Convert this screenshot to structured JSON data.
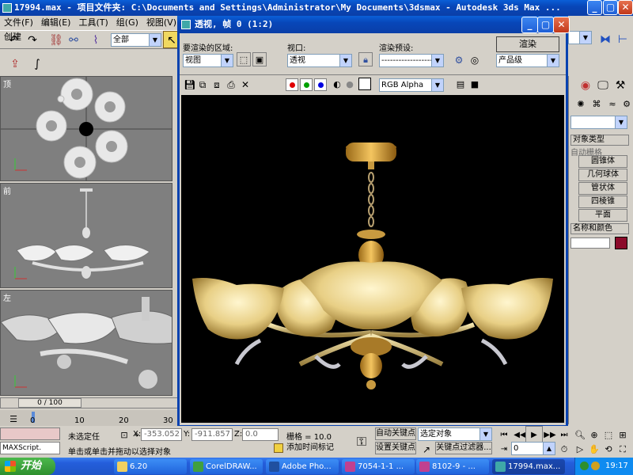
{
  "main_title": "17994.max   - 项目文件夹: C:\\Documents and Settings\\Administrator\\My Documents\\3dsmax   - Autodesk 3ds Max  ...",
  "menu": [
    "文件(F)",
    "编辑(E)",
    "工具(T)",
    "组(G)",
    "视图(V)",
    "创建"
  ],
  "selection_filter": "全部",
  "viewports": {
    "top": "顶",
    "front": "前",
    "left": "左"
  },
  "timeline": {
    "slider": "0 / 100",
    "ticks": [
      "0",
      "10",
      "20",
      "30"
    ]
  },
  "render_window": {
    "title": "透视, 帧 0 (1:2)",
    "area_label": "要渲染的区域:",
    "area_value": "视图",
    "viewport_label": "视口:",
    "viewport_value": "透视",
    "preset_label": "渲染预设:",
    "preset_value": "--------------------",
    "render_button": "渲染",
    "quality_value": "产品级",
    "channel_value": "RGB Alpha",
    "channel_colors": [
      "#e00000",
      "#00a000",
      "#0000e0"
    ]
  },
  "command_panel": {
    "rollout_object_type": "对象类型",
    "autogrid": "自动栅格",
    "buttons": [
      "圆锥体",
      "几何球体",
      "管状体",
      "四棱锥",
      "平面"
    ],
    "rollout_name_color": "名称和颜色",
    "object_color": "#8b0a2a"
  },
  "status": {
    "maxscript": "MAXScript.",
    "selection": "未选定任",
    "prompt": "单击或单击并拖动以选择对象",
    "x_label": "X:",
    "x_value": "-353.052",
    "y_label": "Y:",
    "y_value": "-911.857",
    "z_label": "Z:",
    "z_value": "0.0",
    "grid": "栅格 = 10.0",
    "add_time_tag": "添加时间标记",
    "auto_key": "自动关键点",
    "set_key": "设置关键点",
    "key_mode": "选定对象",
    "key_filters": "关键点过滤器...",
    "frame": "0"
  },
  "taskbar": {
    "start": "开始",
    "items": [
      "6.20",
      "CorelDRAW...",
      "Adobe Pho...",
      "7054-1-1 ...",
      "8102-9 - ...",
      "17994.max..."
    ],
    "clock": "19:17"
  }
}
